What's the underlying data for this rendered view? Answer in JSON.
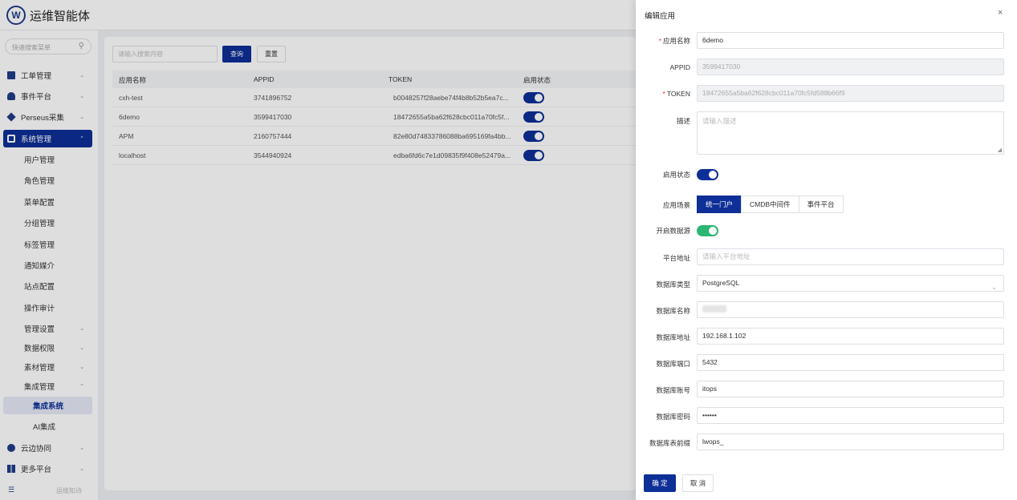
{
  "app": {
    "title": "运维智能体",
    "logo_letter": "W"
  },
  "sidebar": {
    "search_placeholder": "快速搜索菜单",
    "items": [
      {
        "label": "工单管理",
        "icon": "ticket-icon"
      },
      {
        "label": "事件平台",
        "icon": "bell-icon"
      },
      {
        "label": "Perseus采集",
        "icon": "diamond-icon"
      },
      {
        "label": "系统管理",
        "icon": "settings-icon"
      }
    ],
    "subitems": [
      "用户管理",
      "角色管理",
      "菜单配置",
      "分组管理",
      "标签管理",
      "通知媒介",
      "站点配置",
      "操作审计",
      "管理设置",
      "数据权限",
      "素材管理",
      "集成管理"
    ],
    "deep_items": [
      "集成系统",
      "AI集成"
    ],
    "bottom_items": [
      {
        "label": "云边协同",
        "icon": "cloud-icon"
      },
      {
        "label": "更多平台",
        "icon": "grid-icon"
      }
    ],
    "footer": "运维知诗"
  },
  "filter": {
    "placeholder": "请输入搜索内容",
    "query_label": "查询",
    "reset_label": "重置"
  },
  "table": {
    "headers": [
      "应用名称",
      "APPID",
      "TOKEN",
      "启用状态"
    ],
    "rows": [
      [
        "cxh-test",
        "3741896752",
        "b0048257f28aebe74f4b8b52b5ea7c..."
      ],
      [
        "6demo",
        "3599417030",
        "18472655a5ba62f628cbc011a70fc5f..."
      ],
      [
        "APM",
        "2160757444",
        "82e80d74833786088ba695169fa4bb..."
      ],
      [
        "localhost",
        "3544940924",
        "edba6fd6c7e1d09835f9f408e52479a..."
      ]
    ]
  },
  "drawer": {
    "title": "编辑应用",
    "close": "×",
    "fields": {
      "name": {
        "label": "应用名称",
        "value": "6demo"
      },
      "appid": {
        "label": "APPID",
        "value": "3599417030"
      },
      "token": {
        "label": "TOKEN",
        "value": "18472655a5ba62f628cbc011a70fc5fd588b66f9"
      },
      "desc": {
        "label": "描述",
        "placeholder": "请输入描述"
      },
      "enabled": {
        "label": "启用状态"
      },
      "scene": {
        "label": "应用场景",
        "options": [
          "统一门户",
          "CMDB中间件",
          "事件平台"
        ]
      },
      "datasource": {
        "label": "开启数据源"
      },
      "platform_addr": {
        "label": "平台地址",
        "placeholder": "请输入平台地址"
      },
      "db_type": {
        "label": "数据库类型",
        "value": "PostgreSQL"
      },
      "db_name": {
        "label": "数据库名称"
      },
      "db_addr": {
        "label": "数据库地址",
        "value": "192.168.1.102"
      },
      "db_port": {
        "label": "数据库端口",
        "value": "5432"
      },
      "db_user": {
        "label": "数据库账号",
        "value": "itops"
      },
      "db_pass": {
        "label": "数据库密码",
        "value": "••••••"
      },
      "db_prefix": {
        "label": "数据库表前缀",
        "value": "lwops_"
      }
    },
    "ok_label": "确 定",
    "cancel_label": "取 消"
  },
  "colors": {
    "primary": "#0d2f97",
    "toggle_green": "#2bb673",
    "required": "#e33333"
  }
}
